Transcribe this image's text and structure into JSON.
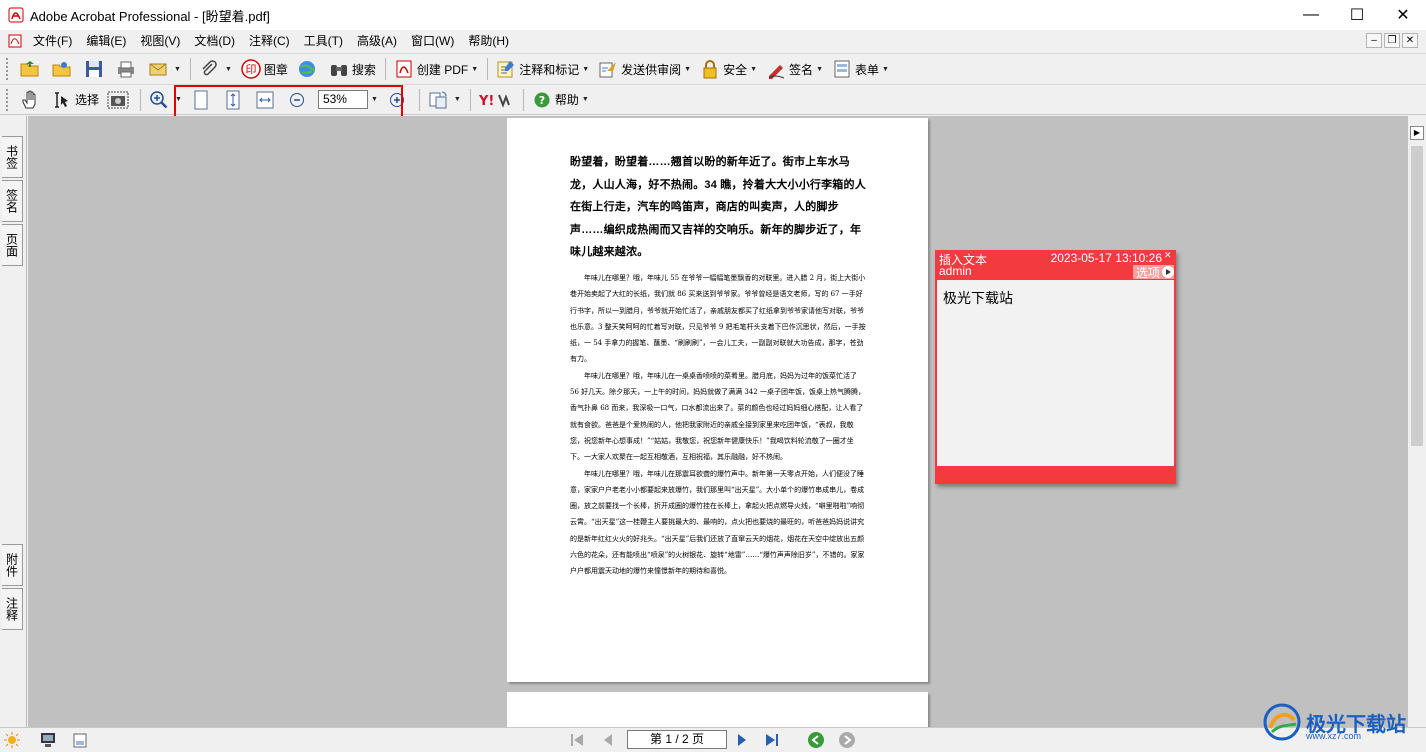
{
  "window": {
    "title": "Adobe Acrobat Professional - [盼望着.pdf]",
    "minimize_glyph": "—",
    "maximize_glyph": "☐",
    "close_glyph": "✕"
  },
  "menu": [
    {
      "label": "文件(F)"
    },
    {
      "label": "编辑(E)"
    },
    {
      "label": "视图(V)"
    },
    {
      "label": "文档(D)"
    },
    {
      "label": "注释(C)"
    },
    {
      "label": "工具(T)"
    },
    {
      "label": "高级(A)"
    },
    {
      "label": "窗口(W)"
    },
    {
      "label": "帮助(H)"
    }
  ],
  "toolbar1": {
    "stamp": "图章",
    "search": "搜索",
    "create_pdf": "创建 PDF",
    "comment_markup": "注释和标记",
    "send_review": "发送供审阅",
    "secure": "安全",
    "sign": "签名",
    "forms": "表单"
  },
  "toolbar2": {
    "select": "选择",
    "zoom_value": "53%",
    "help": "帮助",
    "yahoo": "Y!"
  },
  "left_tabs": {
    "bookmarks": "书签",
    "signatures": "签名",
    "pages": "页面",
    "attachments": "附件",
    "comments": "注释"
  },
  "document": {
    "heading": "盼望着，盼望着……翘首以盼的新年近了。街市上车水马龙，人山人海，好不热闹。34 瞧，拎着大大小小行李箱的人在街上行走，汽车的鸣笛声，商店的叫卖声，人的脚步声……编织成热闹而又吉祥的交响乐。新年的脚步近了，年味儿越来越浓。",
    "paragraphs": [
      "年味儿在哪里？哦，年味儿 55 在爷爷一幅幅笔墨飘香的对联里。进入腊 2 月，街上大街小巷开始卖起了大红的长纸，我们就 86 买来送到爷爷家。爷爷曾经是语文老师，写的 67 一手好行书字，所以一到腊月，爷爷就开始忙活了，亲戚朋友都买了红纸拿到爷爷家请他写对联，爷爷也乐意。3 整天笑呵呵的忙着写对联，只见爷爷 9 把毛笔杆头支着下巴作沉思状，然后，一手按纸，一 54 手拿力的握笔、蘸墨、“刷刷刷”，一会儿工夫，一副副对联就大功告成，那字，苍劲有力。",
      "年味儿在哪里？哦，年味儿在一桌桌香喷喷的菜肴里。腊月底，妈妈为过年的饭菜忙活了 56 好几天。除夕那天，一上午的时间，妈妈就做了满满 342 一桌子团年饭，饭桌上热气腾腾，香气扑鼻 68 而来，我深吸一口气，口水都流出来了。菜的颜色也经过妈妈细心搭配，让人看了就有食欲。爸爸是个爱热闹的人，他把我家附近的亲戚全接到家里来吃团年饭，“表叔，我敬您，祝您新年心想事成！”“姑姑，我敬您，祝您新年健康快乐！”我喝饮料轮流敬了一圈才坐下。一大家人欢聚在一起互相敬酒，互相祝福，其乐融融，好不热闹。",
      "年味儿在哪里？哦，年味儿在那震耳欲聋的爆竹声中。新年第一天零点开始，人们便没了睡意，家家户户老老小小都要起来放爆竹，我们那里叫“出天星”。大小单个的爆竹串成串儿，卷成圈，放之前要找一个长棒，折开成圈的爆竹挂在长棒上，拿起火把点燃导火线，“噼里啪啦”响彻云霄。“出天星”这一桂鞭主人要挑最大的、最响的，点火把也要烧的最旺的，听爸爸妈妈说讲究的是新年红红火火的好兆头。“出天星”后我们还放了直窜云天的烟花，烟花在天空中绽放出五颜六色的花朵，还有能喷出“喷泉”的火树银花、旋转“地雷”……“爆竹声声除旧岁”，不错的。家家户户都用震天动地的爆竹来憧憬新年的期待和喜悦。"
    ]
  },
  "note": {
    "type": "插入文本",
    "date": "2023-05-17 13:10:26",
    "author": "admin",
    "options": "选项",
    "content": "极光下载站"
  },
  "status": {
    "page_indicator": "第 1 / 2 页"
  },
  "watermark": {
    "name": "极光下载站",
    "url": "www.xz7.com"
  },
  "colors": {
    "note": "#f23a3f",
    "highlight": "#e00000",
    "workspace": "#c0c0c0"
  }
}
